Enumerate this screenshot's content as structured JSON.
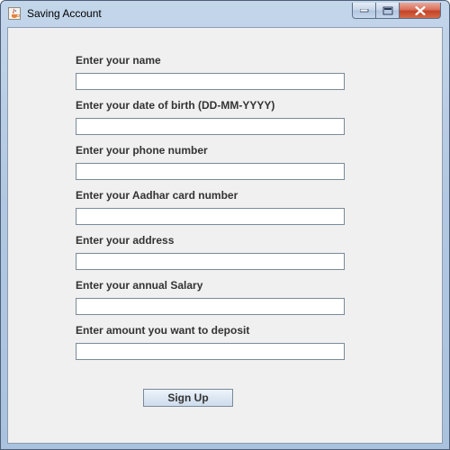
{
  "window": {
    "title": "Saving Account",
    "icon": "java-cup-icon",
    "controls": [
      "minimize-icon",
      "maximize-icon",
      "close-icon"
    ]
  },
  "form": {
    "fields": [
      {
        "label": "Enter your name",
        "value": ""
      },
      {
        "label": "Enter your date of birth (DD-MM-YYYY)",
        "value": ""
      },
      {
        "label": "Enter your phone number",
        "value": ""
      },
      {
        "label": "Enter your Aadhar card number",
        "value": ""
      },
      {
        "label": "Enter your address",
        "value": ""
      },
      {
        "label": "Enter your annual Salary",
        "value": ""
      },
      {
        "label": "Enter amount you want to deposit",
        "value": ""
      }
    ],
    "submit_label": "Sign Up"
  },
  "colors": {
    "title_bar": "#b9cde4",
    "client_background": "#f0f0f0",
    "close_button": "#c4432a",
    "label_text": "#333333"
  }
}
